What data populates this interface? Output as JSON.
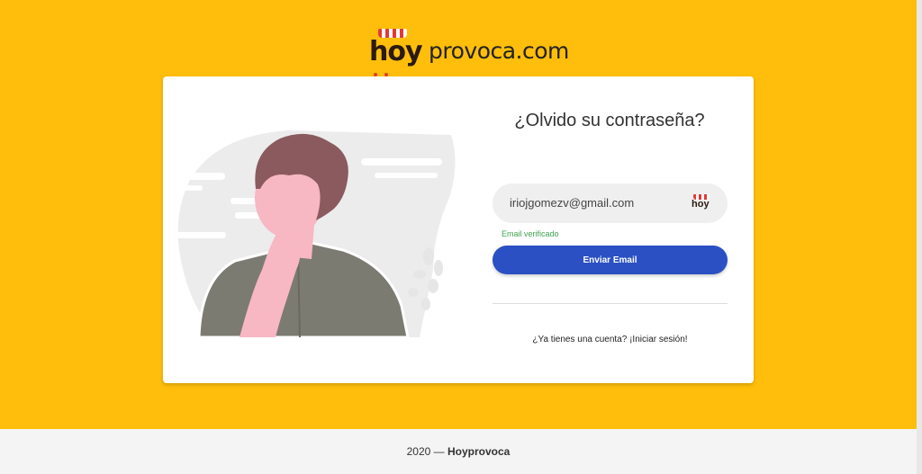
{
  "brand": {
    "logo_prefix": "hoy",
    "logo_suffix": "provoca.com"
  },
  "form": {
    "title": "¿Olvido su contraseña?",
    "email_value": "iriojgomezv@gmail.com",
    "field_icon_text": "hoy",
    "verified_text": "Email verificado",
    "submit_label": "Enviar Email",
    "login_link": "¿Ya tienes una cuenta? ¡Iniciar sesión!"
  },
  "footer": {
    "year_text": "2020 —",
    "brand_name": "Hoyprovoca"
  },
  "colors": {
    "background": "#ffbe0b",
    "button": "#2b50c3",
    "verified": "#3fa34d",
    "accent": "#e53935"
  },
  "icons": {
    "logo": "hoyprovoca-logo",
    "field_icon": "hoy-store-icon",
    "illustration": "thinking-person-illustration"
  }
}
